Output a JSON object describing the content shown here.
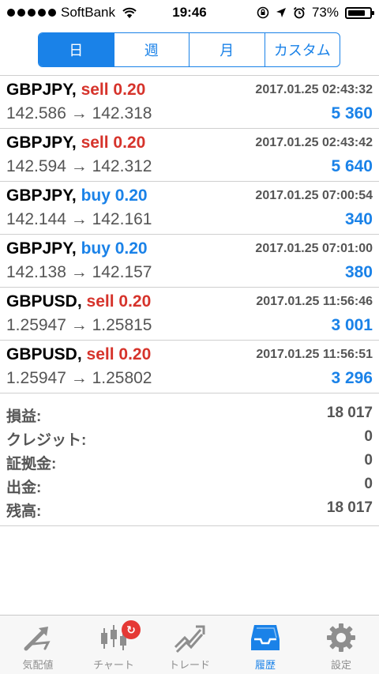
{
  "status_bar": {
    "carrier": "SoftBank",
    "time": "19:46",
    "battery": "73%"
  },
  "period_tabs": [
    {
      "label": "日",
      "active": true
    },
    {
      "label": "週",
      "active": false
    },
    {
      "label": "月",
      "active": false
    },
    {
      "label": "カスタム",
      "active": false
    }
  ],
  "trades": [
    {
      "symbol": "GBPJPY,",
      "side": "sell 0.20",
      "date": "2017.01.25 02:43:32",
      "prices": "142.586 → 142.318",
      "profit": "5 360"
    },
    {
      "symbol": "GBPJPY,",
      "side": "sell 0.20",
      "date": "2017.01.25 02:43:42",
      "prices": "142.594 → 142.312",
      "profit": "5 640"
    },
    {
      "symbol": "GBPJPY,",
      "side": "buy 0.20",
      "date": "2017.01.25 07:00:54",
      "prices": "142.144 → 142.161",
      "profit": "340"
    },
    {
      "symbol": "GBPJPY,",
      "side": "buy 0.20",
      "date": "2017.01.25 07:01:00",
      "prices": "142.138 → 142.157",
      "profit": "380"
    },
    {
      "symbol": "GBPUSD,",
      "side": "sell 0.20",
      "date": "2017.01.25 11:56:46",
      "prices": "1.25947 → 1.25815",
      "profit": "3 001"
    },
    {
      "symbol": "GBPUSD,",
      "side": "sell 0.20",
      "date": "2017.01.25 11:56:51",
      "prices": "1.25947 → 1.25802",
      "profit": "3 296"
    }
  ],
  "summary": {
    "profit_label": "損益:",
    "profit_value": "18 017",
    "credit_label": "クレジット:",
    "credit_value": "0",
    "margin_label": "証拠金:",
    "margin_value": "0",
    "withdrawal_label": "出金:",
    "withdrawal_value": "0",
    "balance_label": "残高:",
    "balance_value": "18 017"
  },
  "tab_bar": {
    "quotes": "気配値",
    "chart": "チャート",
    "trade": "トレード",
    "history": "履歴",
    "settings": "設定",
    "active": "history"
  },
  "colors": {
    "accent": "#1a82e8",
    "sell": "#d6332b",
    "buy": "#1a82e8"
  }
}
